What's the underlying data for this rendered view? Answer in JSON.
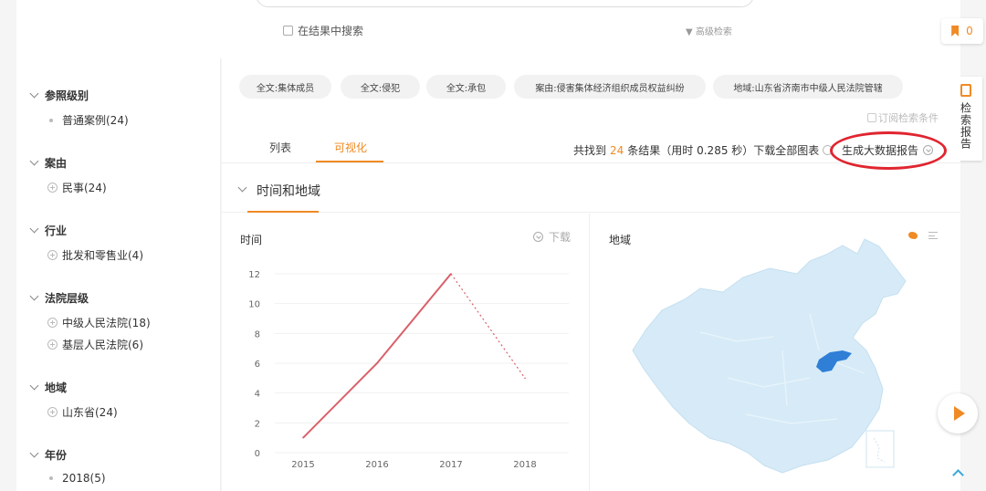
{
  "search": {
    "in_results_label": "在结果中搜索",
    "advanced_label": "▼ 高级检索"
  },
  "side_tools": {
    "favorites_count": "0",
    "report_label": "检索报告"
  },
  "filters": [
    {
      "title": "参照级别",
      "items": [
        {
          "label": "普通案例(24)",
          "marker": "dot"
        }
      ]
    },
    {
      "title": "案由",
      "items": [
        {
          "label": "民事(24)",
          "marker": "plus"
        }
      ]
    },
    {
      "title": "行业",
      "items": [
        {
          "label": "批发和零售业(4)",
          "marker": "plus"
        }
      ]
    },
    {
      "title": "法院层级",
      "items": [
        {
          "label": "中级人民法院(18)",
          "marker": "plus"
        },
        {
          "label": "基层人民法院(6)",
          "marker": "plus"
        }
      ]
    },
    {
      "title": "地域",
      "items": [
        {
          "label": "山东省(24)",
          "marker": "plus"
        }
      ]
    },
    {
      "title": "年份",
      "items": [
        {
          "label": "2018(5)",
          "marker": "dot"
        }
      ]
    }
  ],
  "chips": [
    "全文:集体成员",
    "全文:侵犯",
    "全文:承包",
    "案由:侵害集体经济组织成员权益纠纷",
    "地域:山东省济南市中级人民法院管辖"
  ],
  "subscribe_label": "订阅检索条件",
  "tabs": {
    "list": "列表",
    "visual": "可视化"
  },
  "summary": {
    "prefix": "共找到",
    "count": "24",
    "suffix": "条结果（用时 0.285 秒）下载全部图表",
    "big_data_report": "生成大数据报告"
  },
  "section": {
    "title": "时间和地域"
  },
  "time_panel": {
    "title": "时间",
    "download": "下载"
  },
  "region_panel": {
    "title": "地域"
  },
  "colors": {
    "accent": "#f08a24",
    "line": "#d9606a",
    "map_base": "#d6ebf7",
    "map_highlight": "#2f7fd6",
    "annotation": "#e0252f"
  },
  "chart_data": {
    "type": "line",
    "title": "",
    "xlabel": "",
    "ylabel": "",
    "categories": [
      "2015",
      "2016",
      "2017",
      "2018"
    ],
    "y_ticks": [
      "0",
      "2",
      "4",
      "6",
      "8",
      "10",
      "12"
    ],
    "ylim": [
      0,
      12
    ],
    "series": [
      {
        "values": [
          1,
          6,
          12,
          5
        ],
        "last_segment_dotted": true
      }
    ],
    "grid": true
  }
}
